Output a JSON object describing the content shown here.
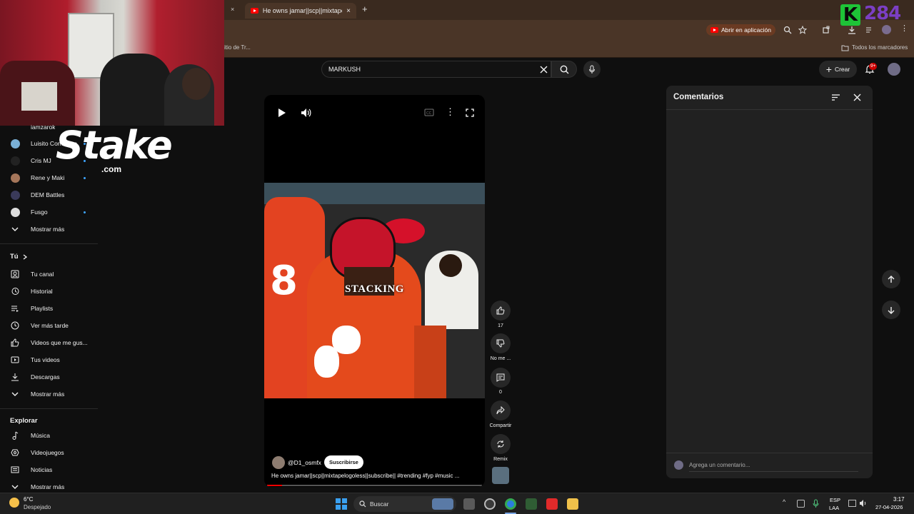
{
  "browser": {
    "tab_title": "He owns jamar||scp||mixtapelogoless||subscribe||",
    "open_in_app": "Abrir en aplicación",
    "bookmark_left": "itio de Tr...",
    "all_bookmarks": "Todos los marcadores"
  },
  "overlay": {
    "stake_brand": "Stake",
    "stake_domain": ".com",
    "k_logo": "K",
    "k_number": "284"
  },
  "header": {
    "search_value": "MARKUSH",
    "create_label": "Crear",
    "notif_count": "9+"
  },
  "sidebar": {
    "subscriptions": [
      {
        "label": "iamzarok",
        "dot": false
      },
      {
        "label": "Luisito Comunica",
        "dot": true
      },
      {
        "label": "Cris MJ",
        "dot": true
      },
      {
        "label": "Rene y Maki",
        "dot": true
      },
      {
        "label": "DEM Battles",
        "dot": false
      },
      {
        "label": "Fusgo",
        "dot": true
      }
    ],
    "show_more_1": "Mostrar más",
    "you_title": "Tú",
    "you_items": [
      "Tu canal",
      "Historial",
      "Playlists",
      "Ver más tarde",
      "Videos que me gus...",
      "Tus videos",
      "Descargas"
    ],
    "show_more_2": "Mostrar más",
    "explore_title": "Explorar",
    "explore_items": [
      "Música",
      "Videojuegos",
      "Noticias"
    ],
    "show_more_3": "Mostrar más"
  },
  "short": {
    "overlay_text": "STACKING",
    "channel": "@D1_osmfx",
    "subscribe": "Suscribirse",
    "description": "He owns jamar||scp||mixtapelogoless||subscribe|| #trending #fyp #music ...",
    "progress_fraction": 0.07
  },
  "actions": {
    "likes": "17",
    "dislike": "No me ...",
    "comments": "0",
    "share": "Compartir",
    "remix": "Remix"
  },
  "comments_panel": {
    "title": "Comentarios",
    "add_placeholder": "Agrega un comentario..."
  },
  "taskbar": {
    "temp": "6°C",
    "weather": "Despejado",
    "search": "Buscar",
    "lang": "ESP",
    "layout": "LAA",
    "time": "3:17",
    "date": "27-04-2026"
  }
}
